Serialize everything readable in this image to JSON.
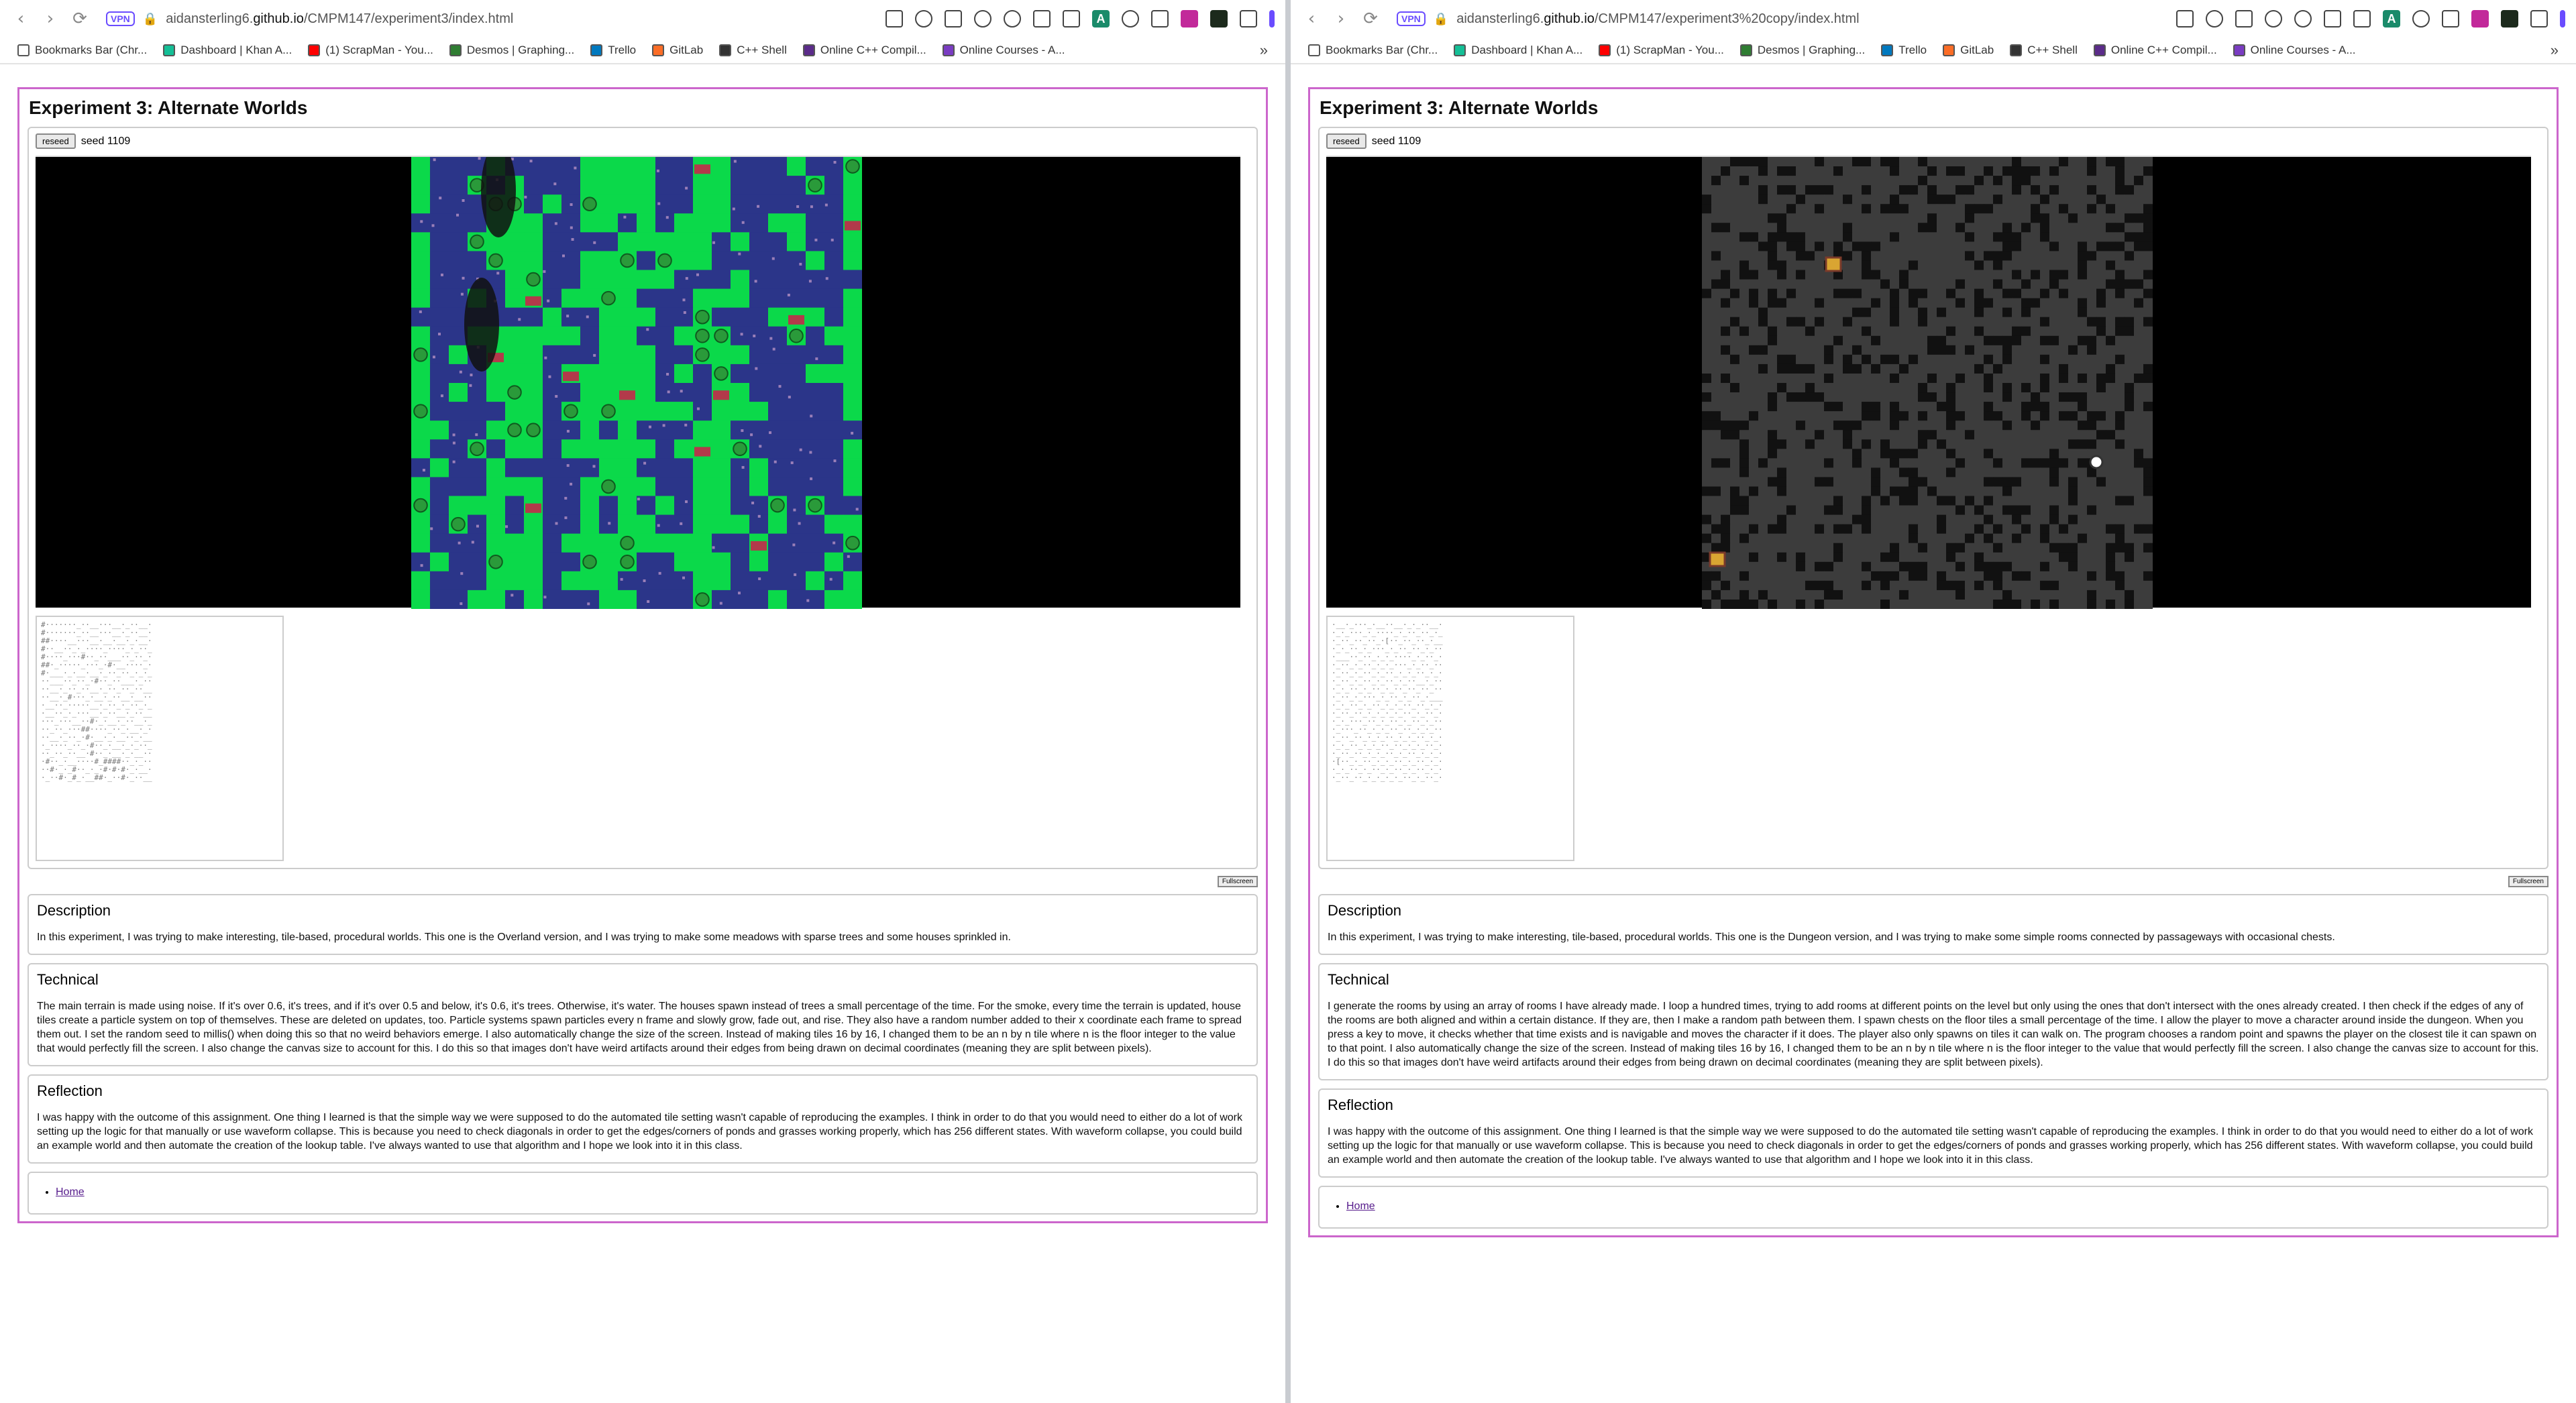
{
  "windows": [
    {
      "url_prefix": "aidansterling6.",
      "url_host": "github.io",
      "url_path": "/CMPM147/experiment3/index.html",
      "page_title": "Experiment 3: Alternate Worlds",
      "reseed_label": "reseed",
      "seed_text": "seed 1109",
      "fullscreen_label": "Fullscreen",
      "map_theme": "overland",
      "ascii": "#·······_··__···__·_··__·\n#·······_··__···__·_··__·\n##····__···__·__·__·_·__·\n#··__··_·_····_····_·_··_\n#····_···#··_··___··_··_·\n##·_·····_···_·#·__····_·\n#·___·_·__·__·_··_··_·_·_\n··___··_··_·#··_··___·_··\n··__·_··_··__·_··_··_··__\n··__·_#···_·__·_··__·__··\n·__··_·····__·_··_·_··_·_\n·__··_·_···__·_··__·_··__\n···_···__··#·_·__·_··__·_\n··_··_···##····_··_·__·_·\n··__·_··_·#·__·_·__··_·__\n·_····_··_·#··_·__·_·_··_\n··_··_··__·#··_·__·_·__··\n·#··_·__····#_####··_·_··\n··#·_·_#··_·_·#·#·#·_·__·\n·_··#·_#_·__##·_··#·_··__",
      "description_title": "Description",
      "description": "In this experiment, I was trying to make interesting, tile-based, procedural worlds. This one is the Overland version, and I was trying to make some meadows with sparse trees and some houses sprinkled in.",
      "technical_title": "Technical",
      "technical": "The main terrain is made using noise. If it's over 0.6, it's trees, and if it's over 0.5 and below, it's 0.6, it's trees. Otherwise, it's water. The houses spawn instead of trees a small percentage of the time. For the smoke, every time the terrain is updated, house tiles create a particle system on top of themselves. These are deleted on updates, too. Particle systems spawn particles every n frame and slowly grow, fade out, and rise. They also have a random number added to their x coordinate each frame to spread them out. I set the random seed to millis() when doing this so that no weird behaviors emerge. I also automatically change the size of the screen. Instead of making tiles 16 by 16, I changed them to be an n by n tile where n is the floor integer to the value that would perfectly fill the screen. I also change the canvas size to account for this. I do this so that images don't have weird artifacts around their edges from being drawn on decimal coordinates (meaning they are split between pixels).",
      "reflection_title": "Reflection",
      "reflection": "I was happy with the outcome of this assignment. One thing I learned is that the simple way we were supposed to do the automated tile setting wasn't capable of reproducing the examples. I think in order to do that you would need to either do a lot of work setting up the logic for that manually or use waveform collapse. This is because you need to check diagonals in order to get the edges/corners of ponds and grasses working properly, which has 256 different states. With waveform collapse, you could build an example world and then automate the creation of the lookup table. I've always wanted to use that algorithm and I hope we look into it in this class.",
      "home_link": "Home"
    },
    {
      "url_prefix": "aidansterling6.",
      "url_host": "github.io",
      "url_path": "/CMPM147/experiment3%20copy/index.html",
      "page_title": "Experiment 3: Alternate Worlds",
      "reseed_label": "reseed",
      "seed_text": "seed 1109",
      "fullscreen_label": "Fullscreen",
      "map_theme": "dungeon",
      "ascii": "·__·_···_·__··__·_·_··__·\n·_·_···_·_····_·_··_··_·_\n·_··_··_··_·[··_··_··_·__\n·_·_··_·_···_·_··_··_·_··\n·___··_··_·_·_····_·_··_·\n·_··_·_··_·_·_···_·_··_··\n·_··_·_··_·_··_·_·_··_·_·\n·_··_·_··_·_··_·_··__·_··\n·_·_··_·_··_·_··_··_··_··\n·_··_·_···_·_··_·_··_·___\n·_·_··_·_··_·_·_··_··_·_·\n·_··_··_·_·_·_·_··_·_··_·\n·_·_···_··_·_··_·_··_·_··\n·_···_··_·_·_··_··_·_·_··\n·_··_··_·_·_··_·_·_··_·_·\n·_·_··_·_·_··_··_·_·_··_·\n·_··_··_·_·_··_·_··_·_·_·\n·[··_·_··_·_·_··_·_··_·_·\n·_·_··_·_··_·_··_·_··_·_·\n·_··_··_·_·_·_·_··_·_··_·",
      "description_title": "Description",
      "description": "In this experiment, I was trying to make interesting, tile-based, procedural worlds. This one is the Dungeon version, and I was trying to make some simple rooms connected by passageways with occasional chests.",
      "technical_title": "Technical",
      "technical": "I generate the rooms by using an array of rooms I have already made. I loop a hundred times, trying to add rooms at different points on the level but only using the ones that don't intersect with the ones already created. I then check if the edges of any of the rooms are both aligned and within a certain distance. If they are, then I make a random path between them. I spawn chests on the floor tiles a small percentage of the time. I allow the player to move a character around inside the dungeon. When you press a key to move, it checks whether that time exists and is navigable and moves the character if it does. The player also only spawns on tiles it can walk on. The program chooses a random point and spawns the player on the closest tile it can spawn on to that point. I also automatically change the size of the screen. Instead of making tiles 16 by 16, I changed them to be an n by n tile where n is the floor integer to the value that would perfectly fill the screen. I also change the canvas size to account for this. I do this so that images don't have weird artifacts around their edges from being drawn on decimal coordinates (meaning they are split between pixels).",
      "reflection_title": "Reflection",
      "reflection": "I was happy with the outcome of this assignment. One thing I learned is that the simple way we were supposed to do the automated tile setting wasn't capable of reproducing the examples. I think in order to do that you would need to either do a lot of work setting up the logic for that manually or use waveform collapse. This is because you need to check diagonals in order to get the edges/corners of ponds and grasses working properly, which has 256 different states. With waveform collapse, you could build an example world and then automate the creation of the lookup table. I've always wanted to use that algorithm and I hope we look into it in this class.",
      "home_link": "Home"
    }
  ],
  "bookmarks": [
    {
      "label": "Bookmarks Bar (Chr...",
      "icon": "folder-icon",
      "color": "#ffffff"
    },
    {
      "label": "Dashboard | Khan A...",
      "icon": "khan-academy-icon",
      "color": "#14bf96"
    },
    {
      "label": "(1) ScrapMan - You...",
      "icon": "youtube-icon",
      "color": "#ff0000"
    },
    {
      "label": "Desmos | Graphing...",
      "icon": "desmos-icon",
      "color": "#2f7d32"
    },
    {
      "label": "Trello",
      "icon": "trello-icon",
      "color": "#0079bf"
    },
    {
      "label": "GitLab",
      "icon": "gitlab-icon",
      "color": "#fc6d26"
    },
    {
      "label": "C++ Shell",
      "icon": "cpp-shell-icon",
      "color": "#333333"
    },
    {
      "label": "Online C++ Compil...",
      "icon": "compiler-icon",
      "color": "#5b2b8a"
    },
    {
      "label": "Online Courses - A...",
      "icon": "courses-icon",
      "color": "#7a3cc2"
    }
  ],
  "nav": {
    "back": "‹",
    "forward": "›",
    "reload": "⟳",
    "more": "»",
    "vpn": "VPN",
    "profile": "A"
  },
  "colors": {
    "grass": "#0bd94a",
    "water": "#2b3589",
    "dungeon_floor": "#3c3c3c",
    "page_border": "#cc66cc"
  }
}
